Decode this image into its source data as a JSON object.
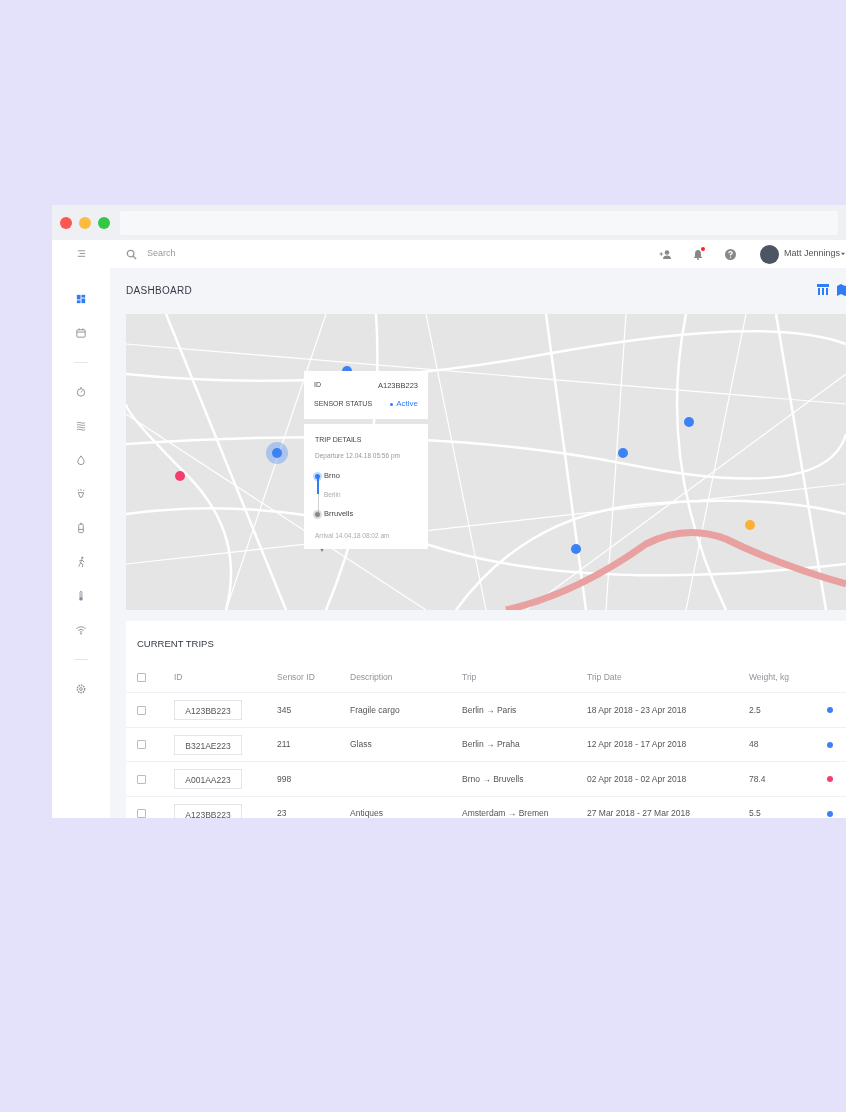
{
  "search": {
    "placeholder": "Search"
  },
  "user": {
    "name": "Matt Jennings",
    "has_notifications": true
  },
  "sidebar": {
    "items": [
      {
        "kind": "menu"
      },
      {
        "kind": "dashboard",
        "selected": true
      },
      {
        "kind": "calendar",
        "selected": false
      },
      {
        "kind": "divider"
      },
      {
        "kind": "timer",
        "selected": false
      },
      {
        "kind": "waves",
        "selected": false
      },
      {
        "kind": "drop",
        "selected": false
      },
      {
        "kind": "bulb",
        "selected": false
      },
      {
        "kind": "battery",
        "selected": false
      },
      {
        "kind": "runner",
        "selected": false
      },
      {
        "kind": "thermometer",
        "selected": false
      },
      {
        "kind": "wifi",
        "selected": false
      },
      {
        "kind": "divider"
      },
      {
        "kind": "settings",
        "selected": false
      }
    ]
  },
  "page_title": "DASHBOARD",
  "views": [
    {
      "kind": "table"
    },
    {
      "kind": "map"
    }
  ],
  "map": {
    "pins": [
      {
        "color": "#3b82f6",
        "focused": false
      },
      {
        "color": "#3b82f6",
        "focused": true
      },
      {
        "color": "#f43f6e",
        "focused": false
      },
      {
        "color": "#3b82f6",
        "focused": false
      },
      {
        "color": "#3b82f6",
        "focused": false
      },
      {
        "color": "#3b82f6",
        "focused": false
      },
      {
        "color": "#fbb034",
        "focused": false
      }
    ],
    "popup": {
      "id_label": "ID",
      "id_value": "A123BB223",
      "status_label": "SENSOR STATUS",
      "status_value": "Active",
      "details_label": "TRIP DETAILS",
      "departure": "Departure 12.04.18 05:56 pm",
      "stops": [
        {
          "name": "Brno",
          "kind": "origin"
        },
        {
          "name": "Berlin",
          "kind": "via"
        },
        {
          "name": "Brruvells",
          "kind": "destination"
        }
      ],
      "arrival": "Arrival 14.04.18 08:02 am"
    }
  },
  "trips": {
    "title": "CURRENT TRIPS",
    "all_checked": false,
    "columns": [
      "ID",
      "Sensor ID",
      "Description",
      "Trip",
      "Trip Date",
      "Weight, kg"
    ],
    "rows": [
      {
        "checked": false,
        "id": "A123BB223",
        "sensor_id": "345",
        "description": "Fragile cargo",
        "trip": "Berlin → Paris",
        "trip_date": "18 Apr 2018 - 23 Apr 2018",
        "weight": "2.5",
        "color": "#3b82f6"
      },
      {
        "checked": false,
        "id": "B321AE223",
        "sensor_id": "211",
        "description": "Glass",
        "trip": "Berlin → Praha",
        "trip_date": "12 Apr 2018 - 17 Apr 2018",
        "weight": "48",
        "color": "#3b82f6"
      },
      {
        "checked": false,
        "id": "A001AA223",
        "sensor_id": "998",
        "trip": "Brno → Bruvells",
        "trip_date": "02 Apr 2018 - 02 Apr 2018",
        "weight": "78.4",
        "color": "#f43f6e"
      },
      {
        "checked": false,
        "id": "A123BB223",
        "sensor_id": "23",
        "description": "Antiques",
        "trip": "Amsterdam → Bremen",
        "trip_date": "27 Mar 2018 - 27 Mar 2018",
        "weight": "5.5",
        "color": "#3b82f6"
      }
    ]
  }
}
